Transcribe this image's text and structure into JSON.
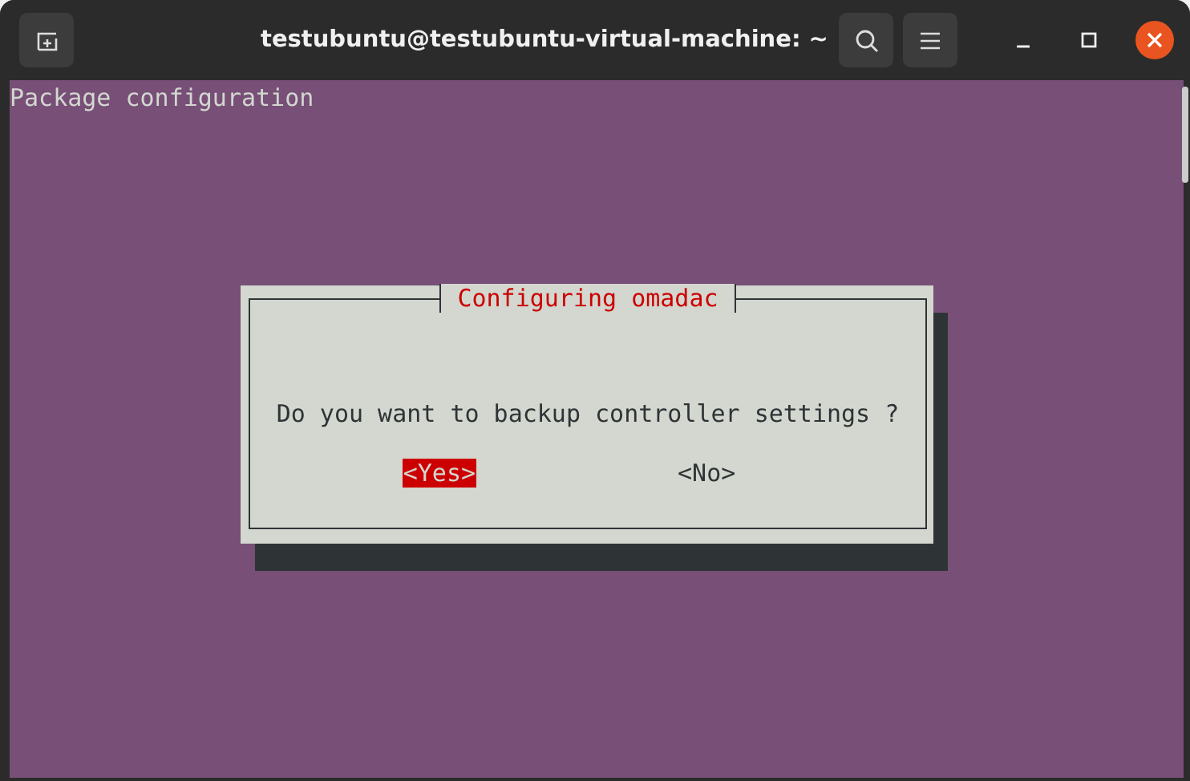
{
  "window": {
    "title": "testubuntu@testubuntu-virtual-machine: ~"
  },
  "terminal": {
    "header": "Package configuration",
    "dialog": {
      "title": "Configuring omadac",
      "question": "Do you want to backup controller settings ?",
      "buttons": [
        {
          "label": "<Yes>",
          "selected": true
        },
        {
          "label": "<No>",
          "selected": false
        }
      ]
    }
  }
}
